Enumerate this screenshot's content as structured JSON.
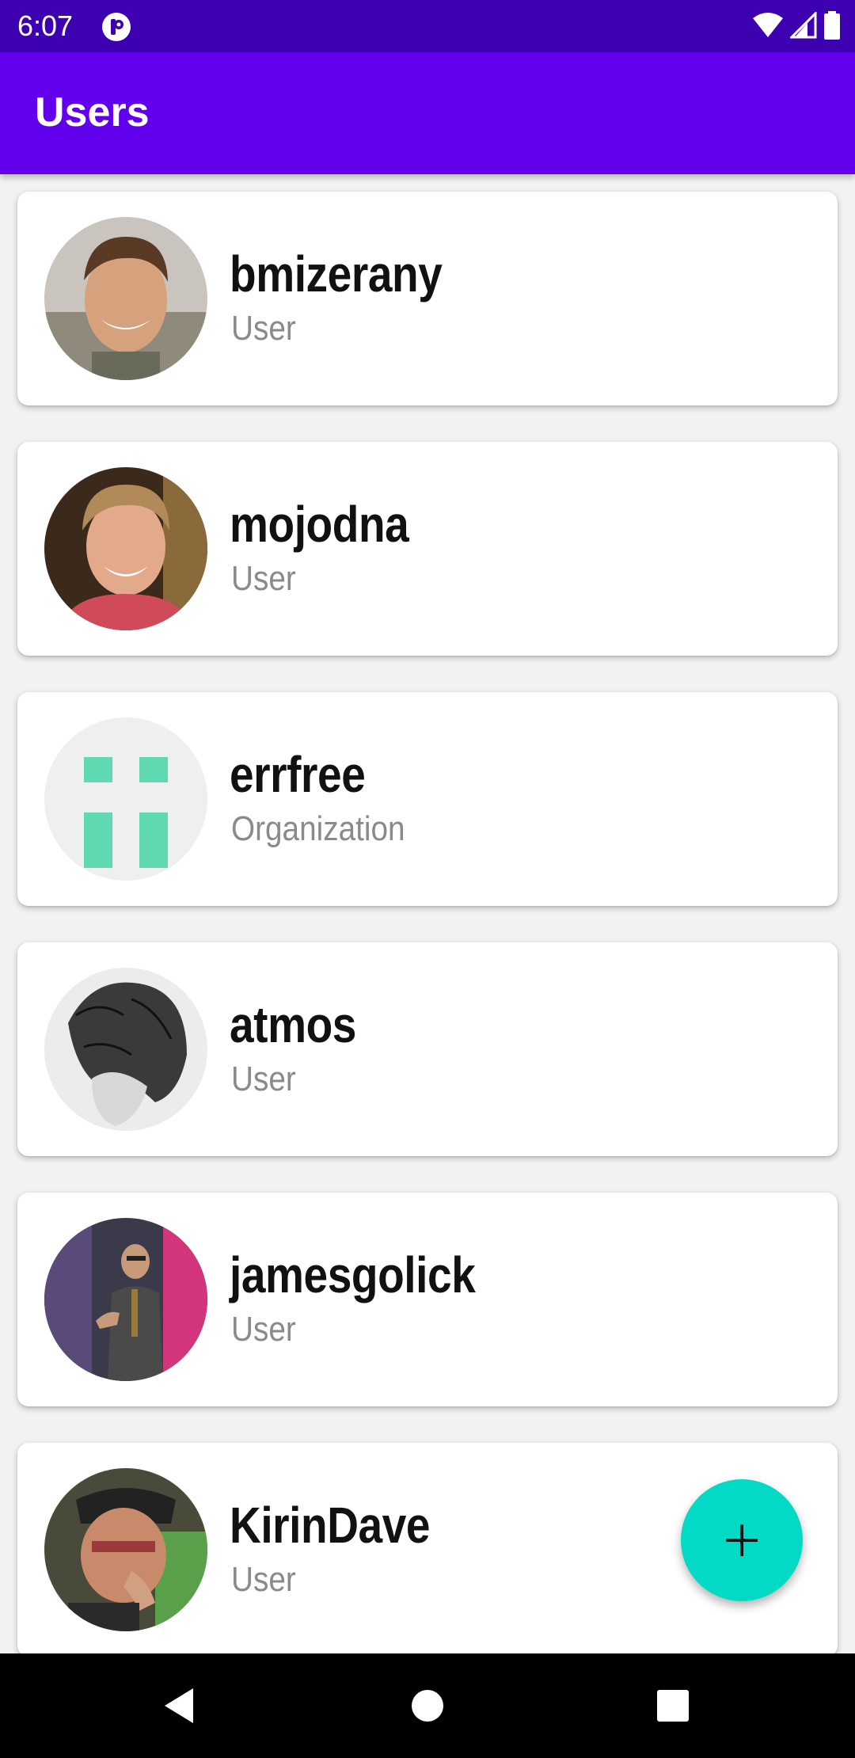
{
  "status_bar": {
    "time": "6:07",
    "icons": [
      "notification-icon",
      "wifi-icon",
      "signal-icon",
      "battery-icon"
    ]
  },
  "app_bar": {
    "title": "Users"
  },
  "users": [
    {
      "name": "bmizerany",
      "type": "User",
      "avatar": "photo"
    },
    {
      "name": "mojodna",
      "type": "User",
      "avatar": "photo"
    },
    {
      "name": "errfree",
      "type": "Organization",
      "avatar": "identicon"
    },
    {
      "name": "atmos",
      "type": "User",
      "avatar": "photo"
    },
    {
      "name": "jamesgolick",
      "type": "User",
      "avatar": "photo"
    },
    {
      "name": "KirinDave",
      "type": "User",
      "avatar": "photo"
    }
  ],
  "fab": {
    "icon": "plus-icon"
  },
  "nav_bar": {
    "icons": [
      "back-icon",
      "home-icon",
      "recents-icon"
    ]
  },
  "colors": {
    "status_bar": "#3d01b2",
    "app_bar": "#6200ee",
    "fab": "#03dac5",
    "identicon": "#5fd9b1"
  }
}
